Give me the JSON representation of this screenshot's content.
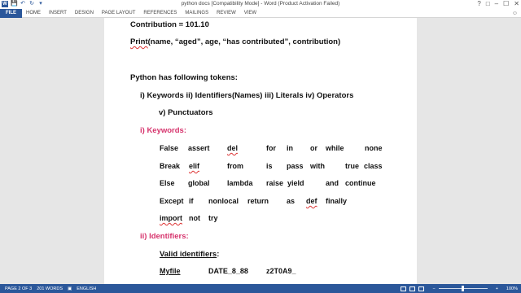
{
  "window": {
    "title": "python docs [Compatibility Mode] - Word (Product Activation Failed)",
    "word_icon": "W",
    "qat_icons": [
      "save-icon",
      "undo-icon",
      "redo-icon",
      "customize-icon"
    ],
    "controls": [
      "?",
      "□",
      "–",
      "☐",
      "✕"
    ]
  },
  "ribbon": {
    "file": "FILE",
    "tabs": [
      "HOME",
      "INSERT",
      "DESIGN",
      "PAGE LAYOUT",
      "REFERENCES",
      "MAILINGS",
      "REVIEW",
      "VIEW"
    ],
    "right": "☺"
  },
  "doc": {
    "contribution": "Contribution = 101.10",
    "print_word": "Print",
    "print_rest": "(name, “aged”, age, “has contributed”, contribution)",
    "tokens_heading": "Python has following tokens:",
    "tokens_list": "i)   Keywords ii) Identifiers(Names) iii) Literals iv) Operators",
    "punctuators": "v) Punctuators",
    "keywords_heading": "i)   Keywords:",
    "kw_rows": [
      [
        "False",
        "assert",
        "del",
        "for",
        "in",
        "or",
        "while",
        "none"
      ],
      [
        "Break",
        "elif",
        "from",
        "is",
        "pass",
        "with",
        "true",
        "class"
      ],
      [
        "Else",
        "global",
        "lambda",
        "raise",
        "yield",
        "and",
        "continue"
      ],
      [
        "Except",
        "if",
        "nonlocal",
        "return",
        "as",
        "def",
        "finally"
      ],
      [
        "import",
        "not",
        "try"
      ]
    ],
    "identifiers_heading": "ii)  Identifiers:",
    "valid_identifiers": "Valid identifiers",
    "valid_colon": ":",
    "ident_examples": [
      "Myfile",
      "DATE_8_88",
      "z2T0A9_"
    ]
  },
  "status": {
    "page": "PAGE 2 OF 3",
    "words": "201 WORDS",
    "lang": "ENGLISH",
    "zoom": "100%"
  }
}
